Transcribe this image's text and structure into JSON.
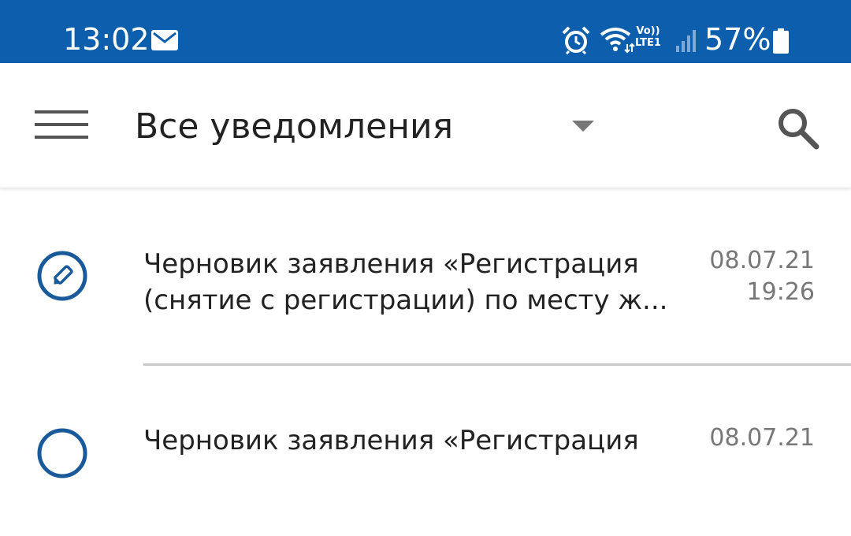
{
  "status_bar": {
    "time": "13:02",
    "volte_top": "Vo))",
    "volte_bottom": "LTE1",
    "battery": "57%",
    "background_color": "#0d5fad",
    "icons": [
      "mail-icon",
      "alarm-icon",
      "wifi-icon",
      "signal-icon",
      "battery-icon"
    ]
  },
  "app_bar": {
    "title": "Все уведомления",
    "menu_icon": "hamburger-menu-icon",
    "dropdown_icon": "dropdown-arrow-icon",
    "search_icon": "search-icon"
  },
  "notifications": [
    {
      "icon": "draft-pencil-icon",
      "line1": "Черновик заявления «Регистрация",
      "line2": "(снятие с регистрации) по месту ж...",
      "date": "08.07.21",
      "time": "19:26"
    },
    {
      "icon": "draft-pencil-icon",
      "line1": "Черновик заявления «Регистрация",
      "line2": "",
      "date": "08.07.21",
      "time": ""
    }
  ],
  "colors": {
    "accent": "#1a5a9a",
    "text": "#222222",
    "secondary_text": "#777777"
  }
}
